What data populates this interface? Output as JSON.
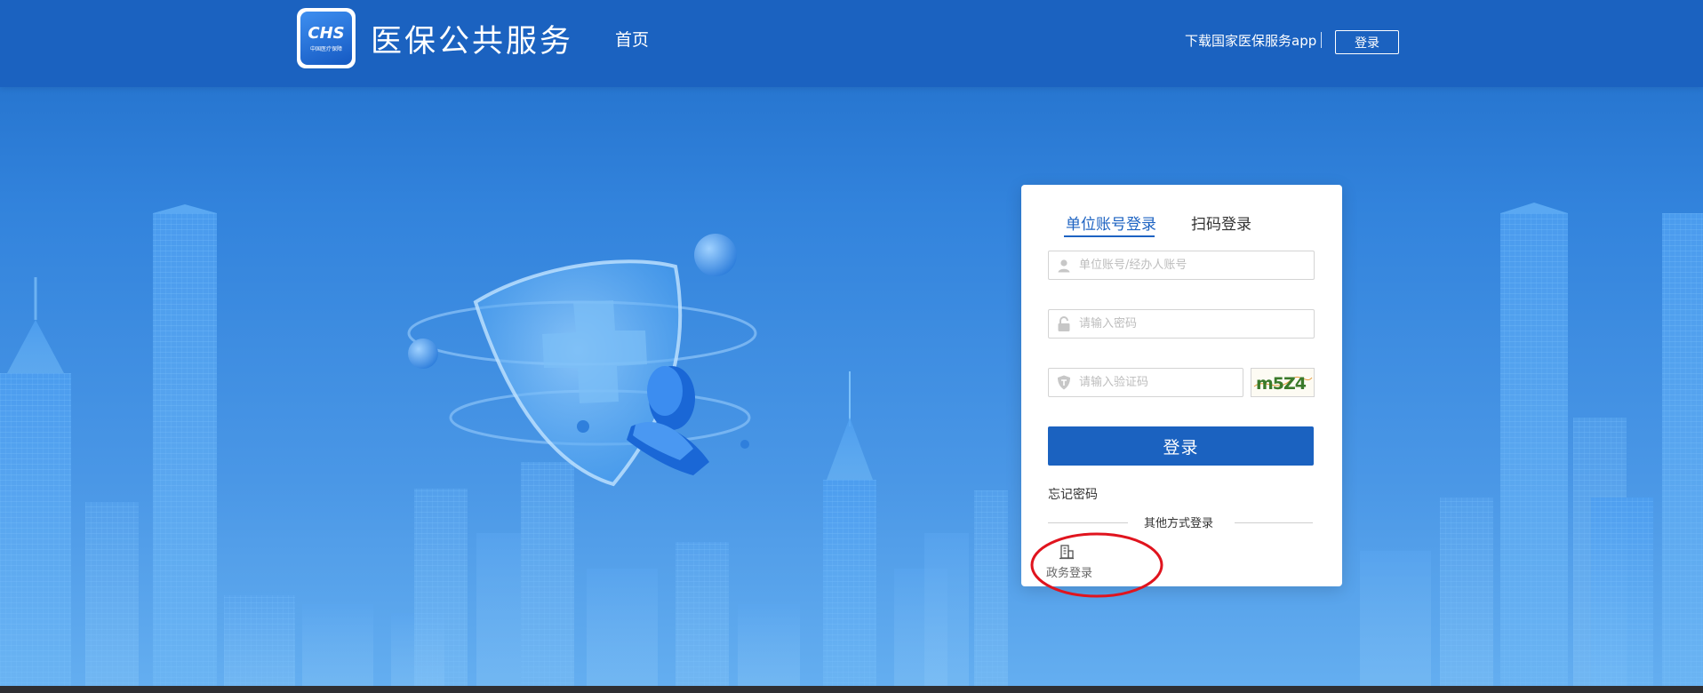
{
  "header": {
    "logo_abbr": "CHS",
    "logo_sub": "中国医疗保障",
    "site_title": "医保公共服务",
    "nav_home": "首页",
    "download_app": "下载国家医保服务app",
    "login_button": "登录"
  },
  "login": {
    "tabs": [
      {
        "label": "单位账号登录",
        "active": true
      },
      {
        "label": "扫码登录",
        "active": false
      }
    ],
    "account_placeholder": "单位账号/经办人账号",
    "password_placeholder": "请输入密码",
    "code_placeholder": "请输入验证码",
    "captcha_text": "m5Z4",
    "submit_label": "登录",
    "forgot_label": "忘记密码",
    "other_methods": "其他方式登录",
    "gov_login_label": "政务登录"
  },
  "colors": {
    "primary": "#1b62c0",
    "header": "#1b62c0",
    "highlight": "#e0141e"
  },
  "icons": [
    "user-icon",
    "lock-icon",
    "shield-icon",
    "building-icon"
  ]
}
